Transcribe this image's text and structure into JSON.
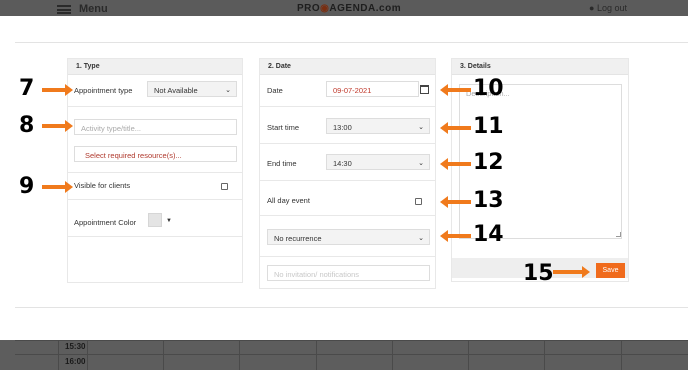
{
  "app": {
    "menu_label": "Menu",
    "logo": "PRO AGENDA.com",
    "logout_label": "Log out"
  },
  "calendar": {
    "times": [
      "15:30",
      "16:00"
    ]
  },
  "type_panel": {
    "title": "1. Type",
    "appointment_type_label": "Appointment type",
    "appointment_type_value": "Not Available",
    "activity_placeholder": "Activity type/title...",
    "resources_link": "Select required resource(s)...",
    "visible_label": "Visible for clients",
    "visible_checked": false,
    "color_label": "Appointment Color",
    "color_value": "#e4e4e4"
  },
  "date_panel": {
    "title": "2. Date",
    "date_label": "Date",
    "date_value": "09-07-2021",
    "start_label": "Start time",
    "start_value": "13:00",
    "end_label": "End time",
    "end_value": "14:30",
    "allday_label": "All day event",
    "allday_checked": false,
    "recurrence_value": "No recurrence",
    "notifications_placeholder": "No invitation/ notifications"
  },
  "details_panel": {
    "title": "3. Details",
    "description_placeholder": "Description...",
    "save_label": "Save"
  },
  "annotations": [
    "7",
    "8",
    "9",
    "10",
    "11",
    "12",
    "13",
    "14",
    "15"
  ],
  "colors": {
    "accent": "#f06b1c",
    "arrow": "#f07a1c",
    "date_text": "#c0392b",
    "resource_text": "#b03a2e"
  }
}
